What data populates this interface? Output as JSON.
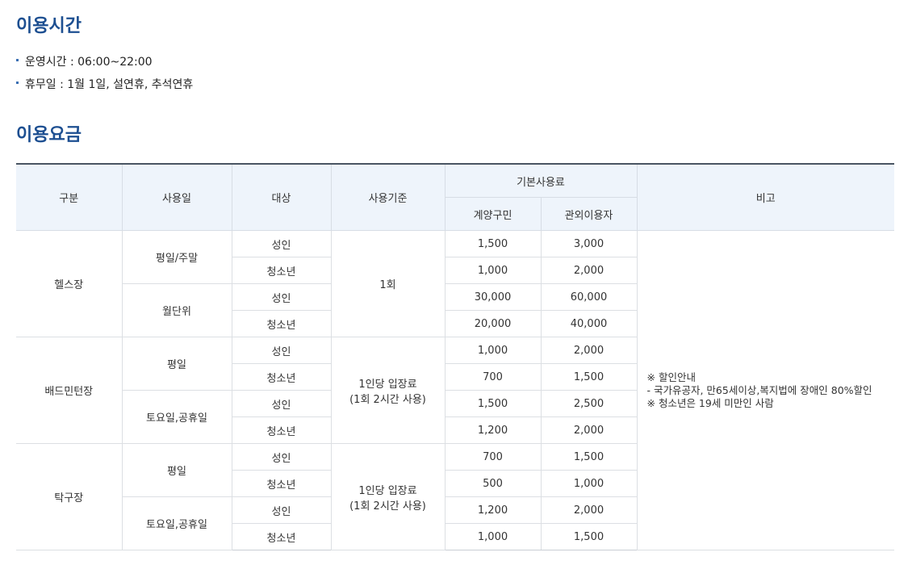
{
  "hours_section": {
    "title": "이용시간",
    "items": [
      {
        "label": "운영시간 : 06:00~22:00"
      },
      {
        "label": "휴무일 : 1월 1일, 설연휴, 추석연휴"
      }
    ]
  },
  "fee_section": {
    "title": "이용요금",
    "headers": {
      "category": "구분",
      "day": "사용일",
      "target": "대상",
      "basis": "사용기준",
      "base_fee": "기본사용료",
      "resident": "계양구민",
      "outsider": "관외이용자",
      "note": "비고"
    },
    "facilities": [
      {
        "name": "헬스장",
        "basis_lines": [
          "1회"
        ],
        "groups": [
          {
            "day": "평일/주말",
            "rows": [
              {
                "target": "성인",
                "resident": "1,500",
                "outsider": "3,000"
              },
              {
                "target": "청소년",
                "resident": "1,000",
                "outsider": "2,000"
              }
            ]
          },
          {
            "day": "월단위",
            "rows": [
              {
                "target": "성인",
                "resident": "30,000",
                "outsider": "60,000"
              },
              {
                "target": "청소년",
                "resident": "20,000",
                "outsider": "40,000"
              }
            ]
          }
        ]
      },
      {
        "name": "배드민턴장",
        "basis_lines": [
          "1인당 입장료",
          "(1회 2시간 사용)"
        ],
        "groups": [
          {
            "day": "평일",
            "rows": [
              {
                "target": "성인",
                "resident": "1,000",
                "outsider": "2,000"
              },
              {
                "target": "청소년",
                "resident": "700",
                "outsider": "1,500"
              }
            ]
          },
          {
            "day": "토요일,공휴일",
            "rows": [
              {
                "target": "성인",
                "resident": "1,500",
                "outsider": "2,500"
              },
              {
                "target": "청소년",
                "resident": "1,200",
                "outsider": "2,000"
              }
            ]
          }
        ]
      },
      {
        "name": "탁구장",
        "basis_lines": [
          "1인당 입장료",
          "(1회 2시간 사용)"
        ],
        "groups": [
          {
            "day": "평일",
            "rows": [
              {
                "target": "성인",
                "resident": "700",
                "outsider": "1,500"
              },
              {
                "target": "청소년",
                "resident": "500",
                "outsider": "1,000"
              }
            ]
          },
          {
            "day": "토요일,공휴일",
            "rows": [
              {
                "target": "성인",
                "resident": "1,200",
                "outsider": "2,000"
              },
              {
                "target": "청소년",
                "resident": "1,000",
                "outsider": "1,500"
              }
            ]
          }
        ]
      }
    ],
    "note_lines": [
      "※ 할인안내",
      "- 국가유공자, 만65세이상,복지법에 장애인 80%할인",
      "※ 청소년은 19세 미만인 사람"
    ]
  }
}
